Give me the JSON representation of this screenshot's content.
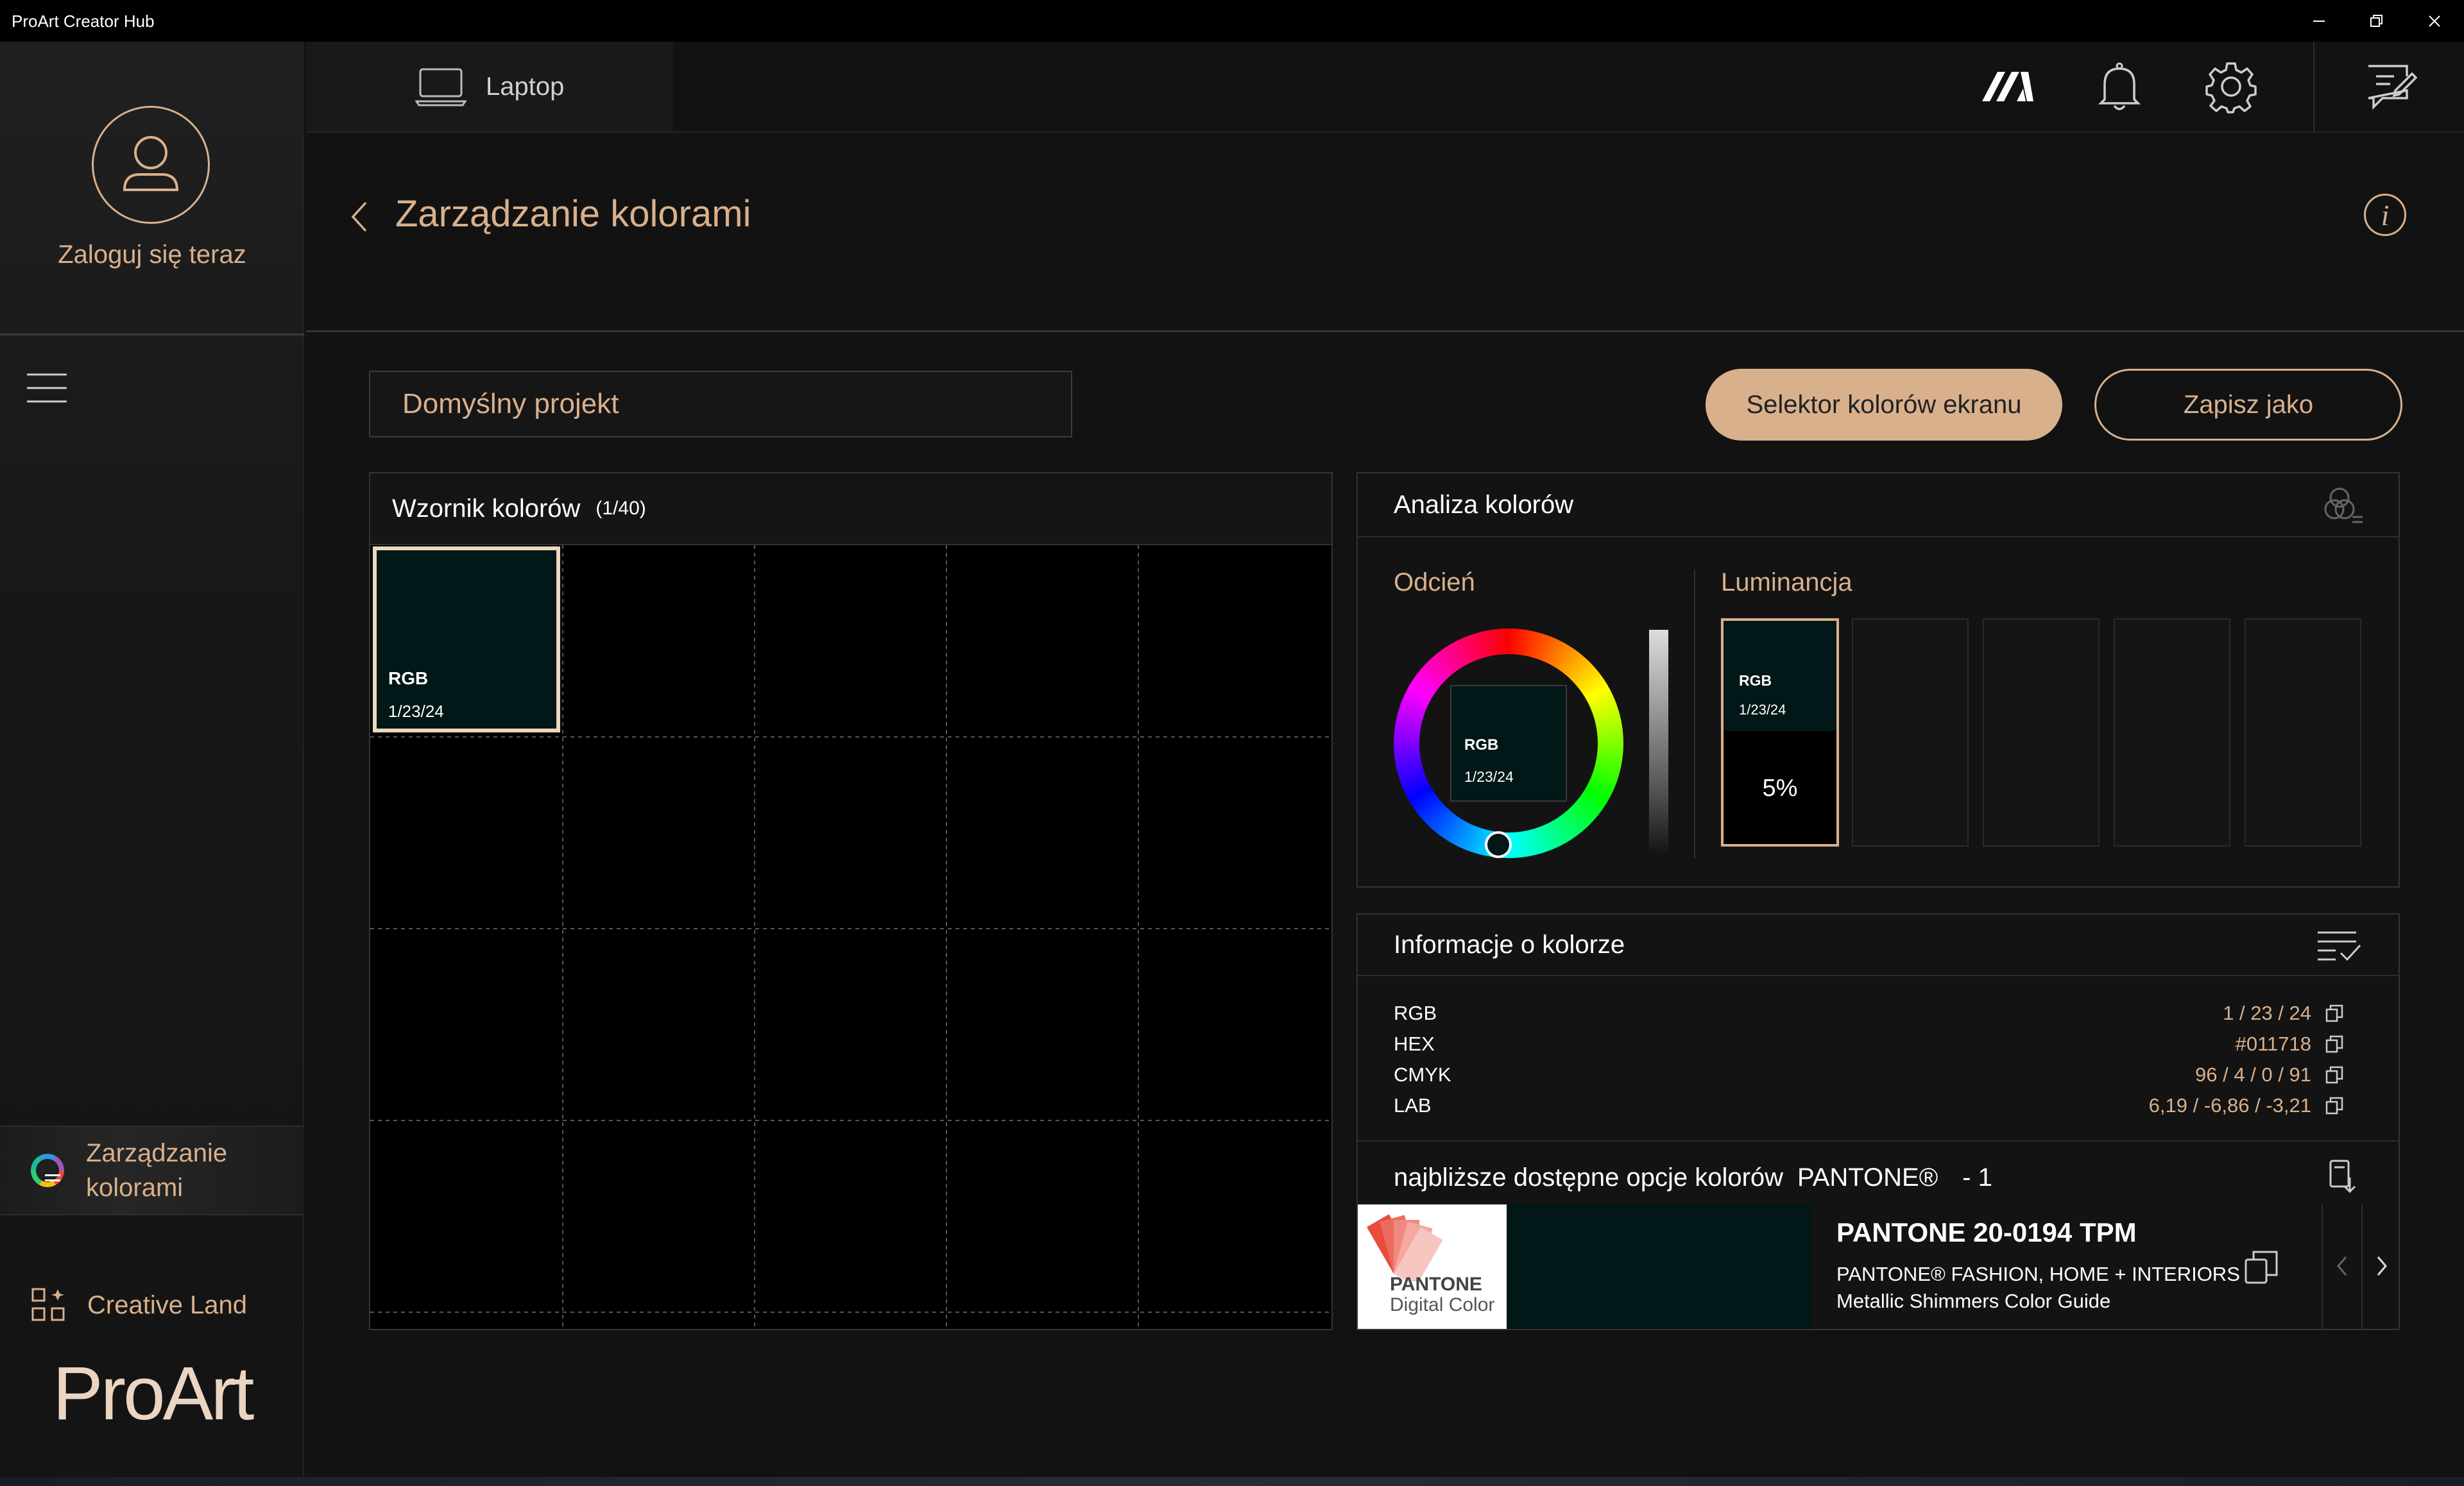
{
  "window": {
    "title": "ProArt Creator Hub"
  },
  "sidebar": {
    "login_label": "Zaloguj się teraz",
    "nav": [
      {
        "label_line1": "Zarządzanie",
        "label_line2": "kolorami",
        "icon": "color-wheel-icon"
      },
      {
        "label": "Creative Land",
        "icon": "apps-grid-icon"
      }
    ],
    "logo_text": "ProArt"
  },
  "header": {
    "device_label": "Laptop",
    "icons": [
      "asus-logo-icon",
      "bell-icon",
      "gear-icon",
      "feedback-icon"
    ]
  },
  "page": {
    "title": "Zarządzanie kolorami"
  },
  "toolbar": {
    "project_value": "Domyślny projekt",
    "picker_button": "Selektor kolorów ekranu",
    "saveas_button": "Zapisz jako"
  },
  "swatches": {
    "title": "Wzornik kolorów",
    "count": "(1/40)",
    "items": [
      {
        "label": "RGB",
        "value": "1/23/24",
        "color": "#011718"
      }
    ]
  },
  "analysis": {
    "title": "Analiza kolorów",
    "hue_title": "Odcień",
    "lum_title": "Luminancja",
    "center_label": "RGB",
    "center_value": "1/23/24",
    "lum_label": "RGB",
    "lum_value": "1/23/24",
    "lum_percent": "5%"
  },
  "info": {
    "title": "Informacje o kolorze",
    "rows": [
      {
        "key": "RGB",
        "value": "1 / 23 / 24"
      },
      {
        "key": "HEX",
        "value": "#011718"
      },
      {
        "key": "CMYK",
        "value": "96 / 4 / 0 / 91"
      },
      {
        "key": "LAB",
        "value": "6,19 / -6,86 / -3,21"
      }
    ],
    "pantone_prefix": "najbliższe dostępne opcje kolorów",
    "pantone_brand": "PANTONE®",
    "pantone_count": "- 1",
    "pantone_logo_line1": "PANTONE",
    "pantone_logo_line2": "Digital Color",
    "pantone_name": "PANTONE 20-0194 TPM",
    "pantone_desc": "PANTONE® FASHION, HOME + INTERIORS Metallic Shimmers Color Guide"
  },
  "colors": {
    "accent": "#d9b08c",
    "swatch": "#011718"
  }
}
